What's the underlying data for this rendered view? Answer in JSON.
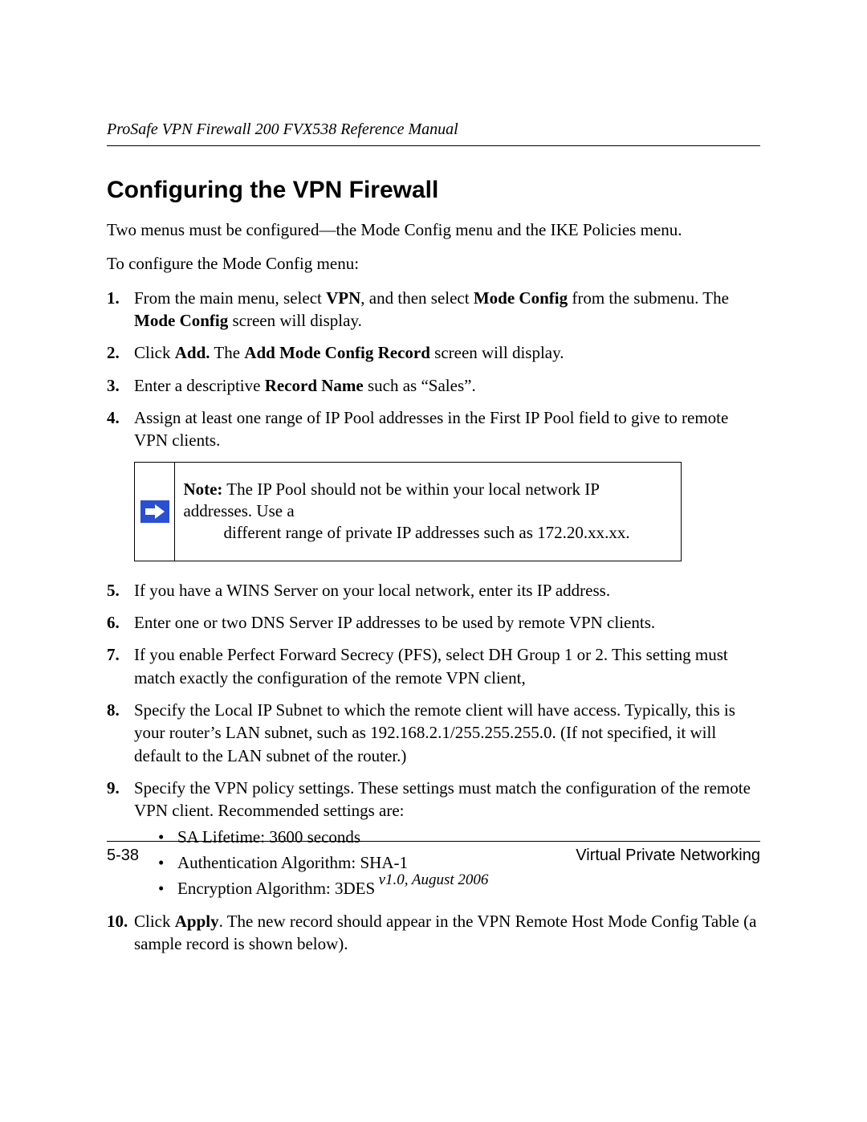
{
  "header": {
    "running_head": "ProSafe VPN Firewall 200 FVX538 Reference Manual"
  },
  "section": {
    "title": "Configuring the VPN Firewall",
    "intro1": "Two menus must be configured—the Mode Config menu and the IKE Policies menu.",
    "intro2": "To configure the Mode Config menu:"
  },
  "steps": [
    {
      "num": "1.",
      "parts": [
        {
          "t": "From the main menu, select "
        },
        {
          "t": "VPN",
          "b": true
        },
        {
          "t": ", and then select "
        },
        {
          "t": "Mode Config",
          "b": true
        },
        {
          "t": " from the submenu. The "
        },
        {
          "t": "Mode Config",
          "b": true
        },
        {
          "t": " screen will display."
        }
      ]
    },
    {
      "num": "2.",
      "parts": [
        {
          "t": "Click "
        },
        {
          "t": "Add.",
          "b": true
        },
        {
          "t": " The "
        },
        {
          "t": "Add Mode Config Record",
          "b": true
        },
        {
          "t": " screen will display."
        }
      ]
    },
    {
      "num": "3.",
      "parts": [
        {
          "t": "Enter a descriptive "
        },
        {
          "t": "Record Name",
          "b": true
        },
        {
          "t": " such as “Sales”."
        }
      ]
    },
    {
      "num": "4.",
      "parts": [
        {
          "t": "Assign at least one range of IP Pool addresses in the First IP Pool field to give to remote VPN clients."
        }
      ]
    }
  ],
  "note": {
    "label": "Note:",
    "line1": " The IP Pool should not be within your local network IP addresses. Use a",
    "line2": "different range of private IP addresses such as 172.20.xx.xx."
  },
  "steps2": [
    {
      "num": "5.",
      "parts": [
        {
          "t": "If you have a WINS Server on your local network, enter its IP address."
        }
      ]
    },
    {
      "num": "6.",
      "parts": [
        {
          "t": "Enter one or two DNS Server IP addresses to be used by remote VPN clients."
        }
      ]
    },
    {
      "num": "7.",
      "parts": [
        {
          "t": "If you enable Perfect Forward Secrecy (PFS), select DH Group 1 or 2. This setting must match exactly the configuration of the remote VPN client,"
        }
      ]
    },
    {
      "num": "8.",
      "parts": [
        {
          "t": "Specify the Local IP Subnet to which the remote client will have access. Typically, this is your router’s LAN subnet, such as 192.168.2.1/255.255.255.0. (If not specified, it will default to the LAN subnet of the router.)"
        }
      ]
    },
    {
      "num": "9.",
      "parts": [
        {
          "t": "Specify the VPN policy settings. These settings must match the configuration of the remote VPN client. Recommended settings are:"
        }
      ],
      "bullets": [
        "SA Lifetime: 3600 seconds",
        "Authentication Algorithm: SHA-1",
        "Encryption Algorithm: 3DES"
      ]
    },
    {
      "num": "10.",
      "parts": [
        {
          "t": "Click "
        },
        {
          "t": "Apply",
          "b": true
        },
        {
          "t": ". The new record should appear in the VPN Remote Host Mode Config Table (a sample record is shown below)."
        }
      ]
    }
  ],
  "footer": {
    "page_num": "5-38",
    "section": "Virtual Private Networking",
    "version": "v1.0, August 2006"
  }
}
